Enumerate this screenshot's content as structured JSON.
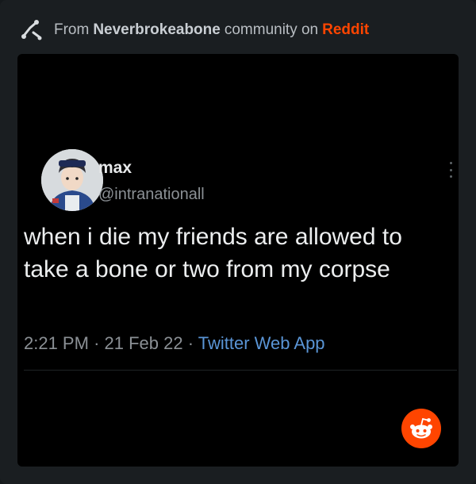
{
  "header": {
    "prefix": "From",
    "community": "Neverbrokeabone",
    "middle": "community on",
    "brand": "Reddit",
    "community_icon": "skeleton-arm-icon"
  },
  "tweet": {
    "display_name": "max",
    "handle": "@intranationall",
    "text": "when i die my friends are allowed to take a bone or two from my corpse",
    "time": "2:21 PM",
    "date": "21 Feb 22",
    "separator": "·",
    "source": "Twitter Web App",
    "source_color": "#5a95d6",
    "menu_icon": "vertical-ellipsis-icon"
  },
  "reddit_button": {
    "icon": "reddit-snoo-icon",
    "color": "#ff4500"
  }
}
